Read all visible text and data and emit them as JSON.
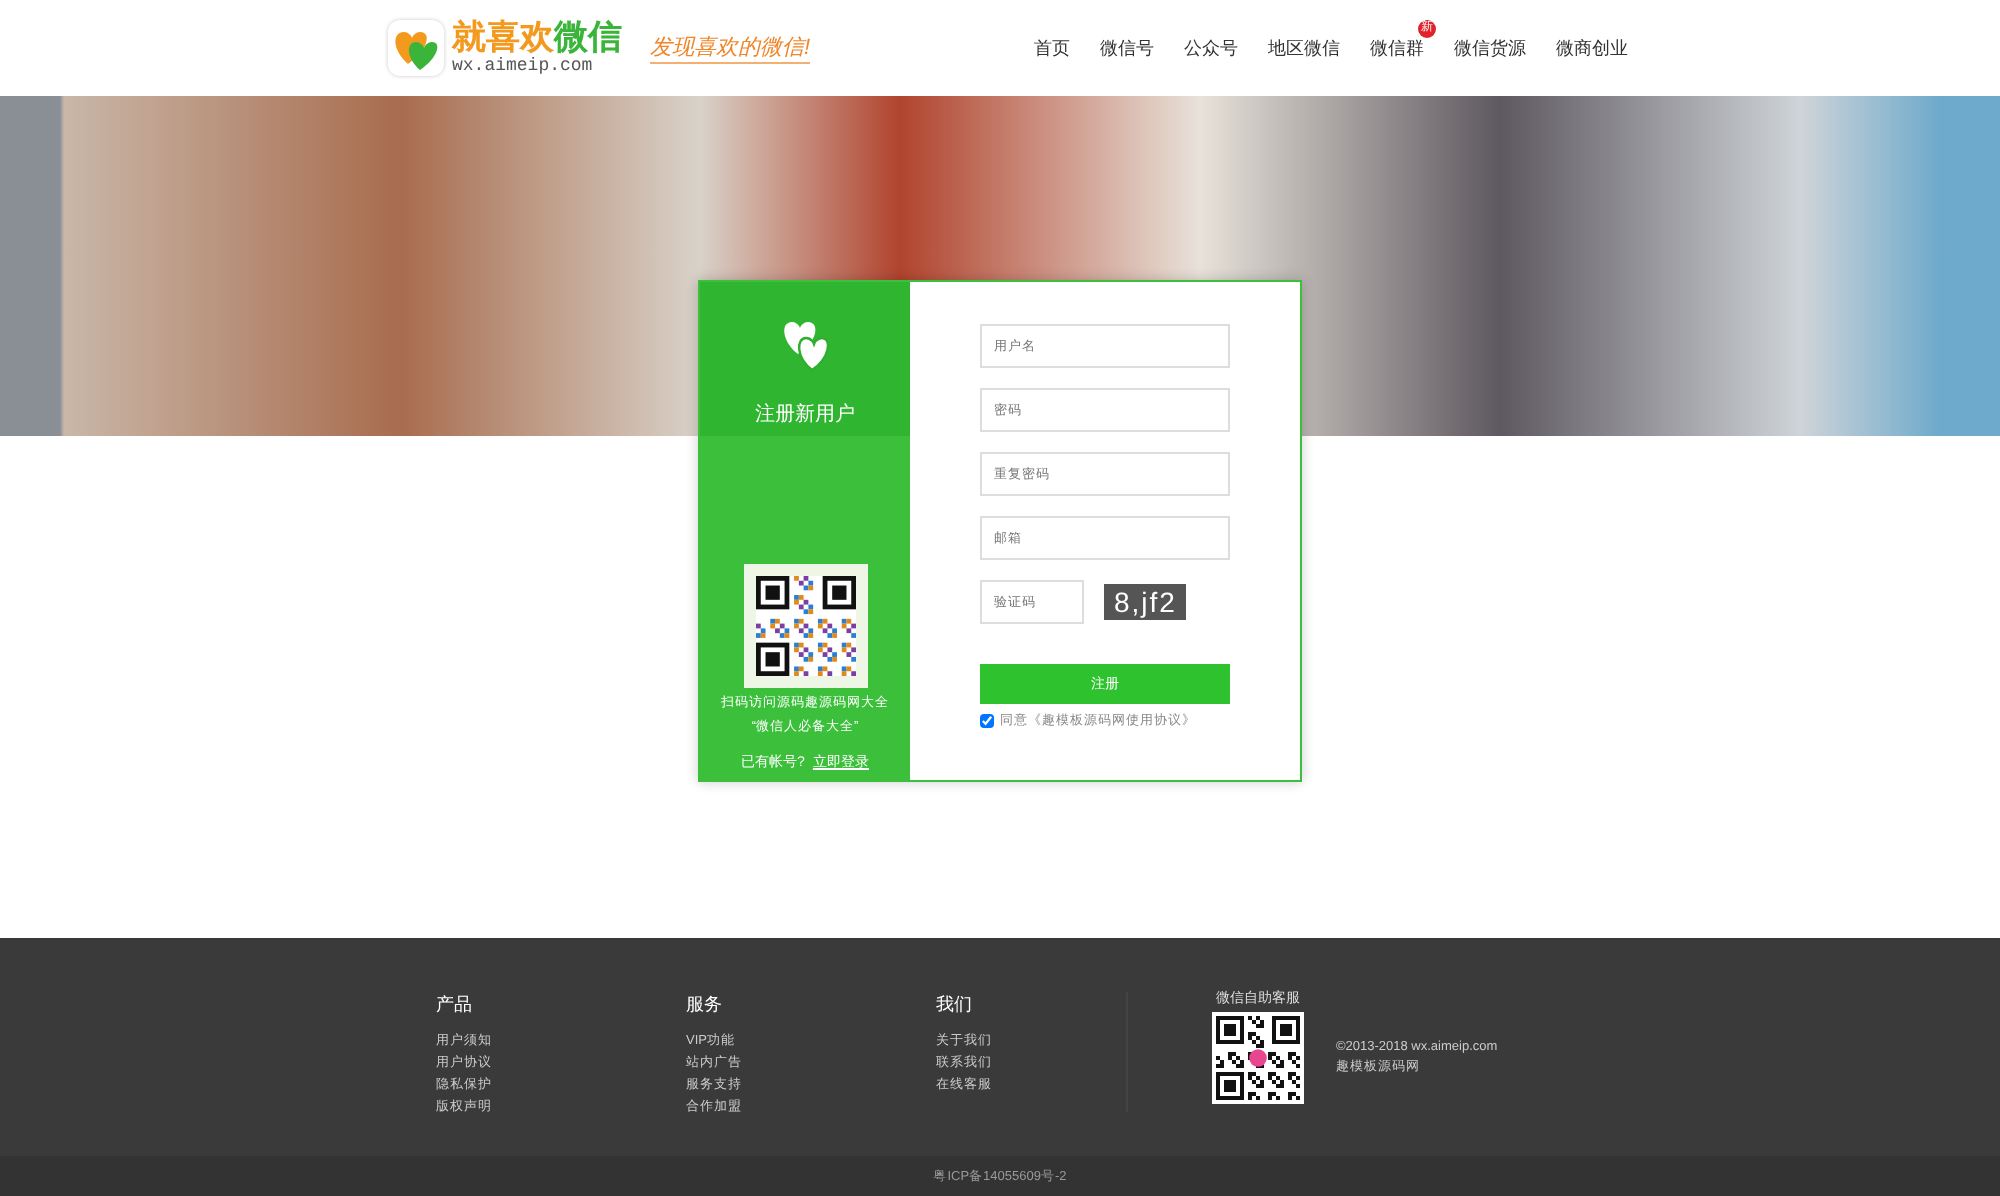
{
  "header": {
    "logo": {
      "title_part1": "就喜欢",
      "title_part2": "微信",
      "domain": "wx.aimeip.com",
      "slogan": "发现喜欢的微信!"
    },
    "nav": [
      {
        "label": "首页"
      },
      {
        "label": "微信号"
      },
      {
        "label": "公众号"
      },
      {
        "label": "地区微信"
      },
      {
        "label": "微信群",
        "badge": "新"
      },
      {
        "label": "微信货源"
      },
      {
        "label": "微商创业"
      }
    ]
  },
  "register_card": {
    "title": "注册新用户",
    "qr_caption": "扫码访问源码趣源码网大全",
    "qr_subcaption": "“微信人必备大全”",
    "login_prompt": "已有帐号?",
    "login_link": "立即登录",
    "fields": [
      {
        "placeholder": "用户名"
      },
      {
        "placeholder": "密码"
      },
      {
        "placeholder": "重复密码"
      },
      {
        "placeholder": "邮箱"
      }
    ],
    "captcha": {
      "placeholder": "验证码",
      "code": "8,jf2"
    },
    "submit": "注册",
    "agree": {
      "checked": true,
      "label": "同意《趣模板源码网使用协议》"
    }
  },
  "footer": {
    "columns": [
      {
        "title": "产品",
        "links": [
          "用户须知",
          "用户协议",
          "隐私保护",
          "版权声明"
        ]
      },
      {
        "title": "服务",
        "links": [
          "VIP功能",
          "站内广告",
          "服务支持",
          "合作加盟"
        ]
      },
      {
        "title": "我们",
        "links": [
          "关于我们",
          "联系我们",
          "在线客服"
        ]
      }
    ],
    "qr_title": "微信自助客服",
    "copyright": "©2013-2018 wx.aimeip.com",
    "site_name": "趣模板源码网",
    "icp": "粤ICP备14055609号-2"
  }
}
